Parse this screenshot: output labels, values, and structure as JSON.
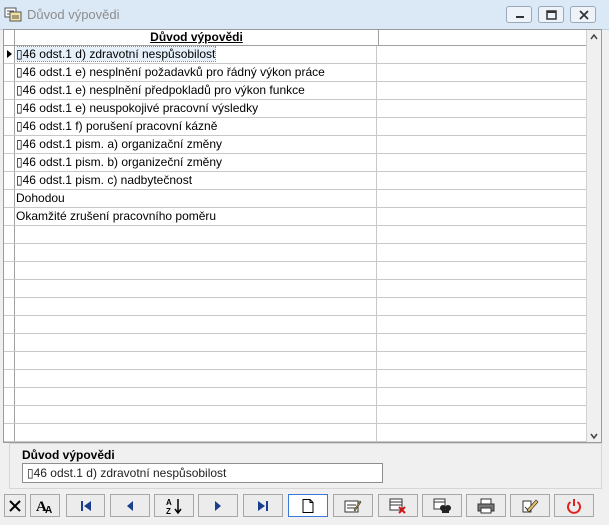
{
  "window": {
    "title": "Důvod výpovědi"
  },
  "grid": {
    "column_header": "Důvod výpovědi",
    "rows": [
      "▯46 odst.1 d) zdravotní nespůsobilost",
      "▯46 odst.1 e) nesplnění požadavků pro řádný výkon práce",
      "▯46 odst.1 e) nesplnění předpokladů pro výkon funkce",
      "▯46 odst.1 e) neuspokojivé pracovní výsledky",
      "▯46 odst.1 f) porušení pracovní kázně",
      "▯46 odst.1 pism. a) organizační změny",
      "▯46 odst.1 pism. b) organizeční změny",
      "▯46 odst.1 pism. c) nadbytečnost",
      "Dohodou",
      "Okamžité zrušení pracovního poměru"
    ],
    "selected_index": 0
  },
  "detail": {
    "label": "Důvod výpovědi",
    "value": "▯46 odst.1 d) zdravotní nespůsobilost"
  },
  "toolbar": {
    "buttons": [
      "cancel-icon",
      "font-icon",
      "first-record-icon",
      "previous-record-icon",
      "sort-icon",
      "next-record-icon",
      "last-record-icon",
      "new-record-icon",
      "edit-record-icon",
      "delete-record-icon",
      "find-icon",
      "print-icon",
      "print-preview-icon",
      "exit-icon"
    ]
  }
}
